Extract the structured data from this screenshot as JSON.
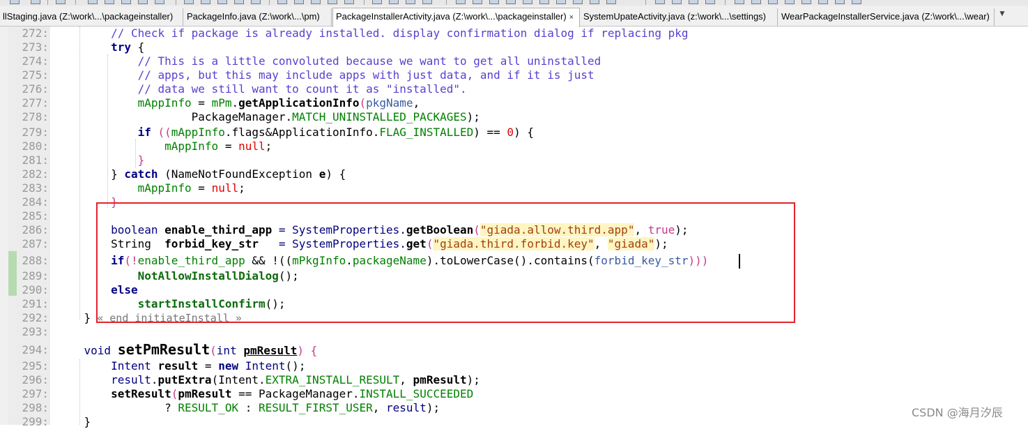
{
  "window": {
    "tabs": [
      {
        "label": "llStaging.java (Z:\\work\\...\\packageinstaller)",
        "active": false
      },
      {
        "label": "PackageInfo.java (Z:\\work\\...\\pm)",
        "active": false
      },
      {
        "label": "PackageInstallerActivity.java (Z:\\work\\...\\packageinstaller)",
        "active": true,
        "close": "×"
      },
      {
        "label": "SystemUpateActivity.java (z:\\work\\...\\settings)",
        "active": false
      },
      {
        "label": "WearPackageInstallerService.java (Z:\\work\\...\\wear)",
        "active": false
      }
    ],
    "tab_scroll_glyph": "▼"
  },
  "editor": {
    "line_numbers": [
      "272:",
      "273:",
      "274:",
      "275:",
      "276:",
      "277:",
      "278:",
      "279:",
      "280:",
      "281:",
      "282:",
      "283:",
      "284:",
      "285:",
      "286:",
      "287:",
      "288:",
      "289:",
      "290:",
      "291:",
      "292:",
      "293:",
      "294:",
      "295:",
      "296:",
      "297:",
      "298:",
      "299:"
    ],
    "lines": {
      "l272": {
        "c1": "// Check if package is already installed. display confirmation dialog if replacing pkg"
      },
      "l273": {
        "kw": "try",
        "t": " {"
      },
      "l274": {
        "c1": "// This is a little convoluted because we want to get all uninstalled"
      },
      "l275": {
        "c1": "// apps, but this may include apps with just data, and if it is just"
      },
      "l276": {
        "c1": "// data we still want to count it as \"installed\"."
      },
      "l277": {
        "f1": "mAppInfo",
        "t1": " = ",
        "f2": "mPm",
        "t2": ".",
        "m": "getApplicationInfo",
        "t3": "(",
        "p": "pkgName",
        "t4": ","
      },
      "l278": {
        "t1": "PackageManager.",
        "f": "MATCH_UNINSTALLED_PACKAGES",
        "t2": ");"
      },
      "l279": {
        "kw": "if",
        "t1": " ((",
        "f1": "mAppInfo",
        "t2": ".flags&ApplicationInfo.",
        "f2": "FLAG_INSTALLED",
        "t3": ") == ",
        "n": "0",
        "t4": ") {"
      },
      "l280": {
        "f": "mAppInfo",
        "t1": " = ",
        "bl": "null",
        "t2": ";"
      },
      "l281": {
        "t": "}"
      },
      "l282": {
        "t1": "} ",
        "kw": "catch",
        "t2": " (NameNotFoundException ",
        "v": "e",
        "t3": ") {"
      },
      "l283": {
        "f": "mAppInfo",
        "t1": " = ",
        "bl": "null",
        "t2": ";"
      },
      "l284": {
        "t": "}"
      },
      "l286": {
        "ty": "boolean",
        "sp": " ",
        "v": "enable_third_app",
        "t1": " = SystemProperties.",
        "m": "getBoolean",
        "t2": "(",
        "s": "\"giada.allow.third.app\"",
        "t3": ", ",
        "b": "true",
        "t4": ");"
      },
      "l287": {
        "ty": "String",
        "sp": "  ",
        "v": "forbid_key_str",
        "t1": "   = SystemProperties.",
        "m": "get",
        "t2": "(",
        "s1": "\"giada.third.forbid.key\"",
        "t3": ", ",
        "s2": "\"giada\"",
        "t4": ");"
      },
      "l288": {
        "kw": "if",
        "t1": "(!",
        "f1": "enable_third_app",
        "t2": " && !((",
        "f2": "mPkgInfo",
        "t3": ".",
        "f3": "packageName",
        "t4": ").toLowerCase().contains(",
        "f4": "forbid_key_str",
        "t5": ")))"
      },
      "l289": {
        "m": "NotAllowInstallDialog",
        "t": "();"
      },
      "l290": {
        "kw": "else"
      },
      "l291": {
        "m": "startInstallConfirm",
        "t": "();"
      },
      "l292": {
        "t": "}",
        "fold": " « end initiateInstall »"
      },
      "l294": {
        "ty": "void",
        "sp": " ",
        "m": "setPmResult",
        "t1": "(",
        "ty2": "int",
        "sp2": " ",
        "p": "pmResult",
        "t2": ") {"
      },
      "l295": {
        "ty": "Intent",
        "sp": " ",
        "v": "result",
        "t1": " = ",
        "kw": "new",
        "sp2": " ",
        "ty2": "Intent",
        "t2": "();"
      },
      "l296": {
        "v1": "result",
        "t1": ".",
        "m": "putExtra",
        "t2": "(Intent.",
        "f": "EXTRA_INSTALL_RESULT",
        "t3": ", ",
        "v2": "pmResult",
        "t4": ");"
      },
      "l297": {
        "m": "setResult",
        "t1": "(",
        "v": "pmResult",
        "t2": " == PackageManager.",
        "f": "INSTALL_SUCCEEDED"
      },
      "l298": {
        "t1": "? ",
        "f1": "RESULT_OK",
        "t2": " : ",
        "f2": "RESULT_FIRST_USER",
        "t3": ", ",
        "v": "result",
        "t4": ");"
      },
      "l299": {
        "t": "}"
      }
    }
  },
  "watermark": "CSDN @海月汐辰",
  "colors": {
    "highlight_box": "#e4222a",
    "keyword": "#000080",
    "comment": "#5a3ed0",
    "field": "#008000",
    "string": "#a0410f",
    "literal": "#e00000"
  }
}
